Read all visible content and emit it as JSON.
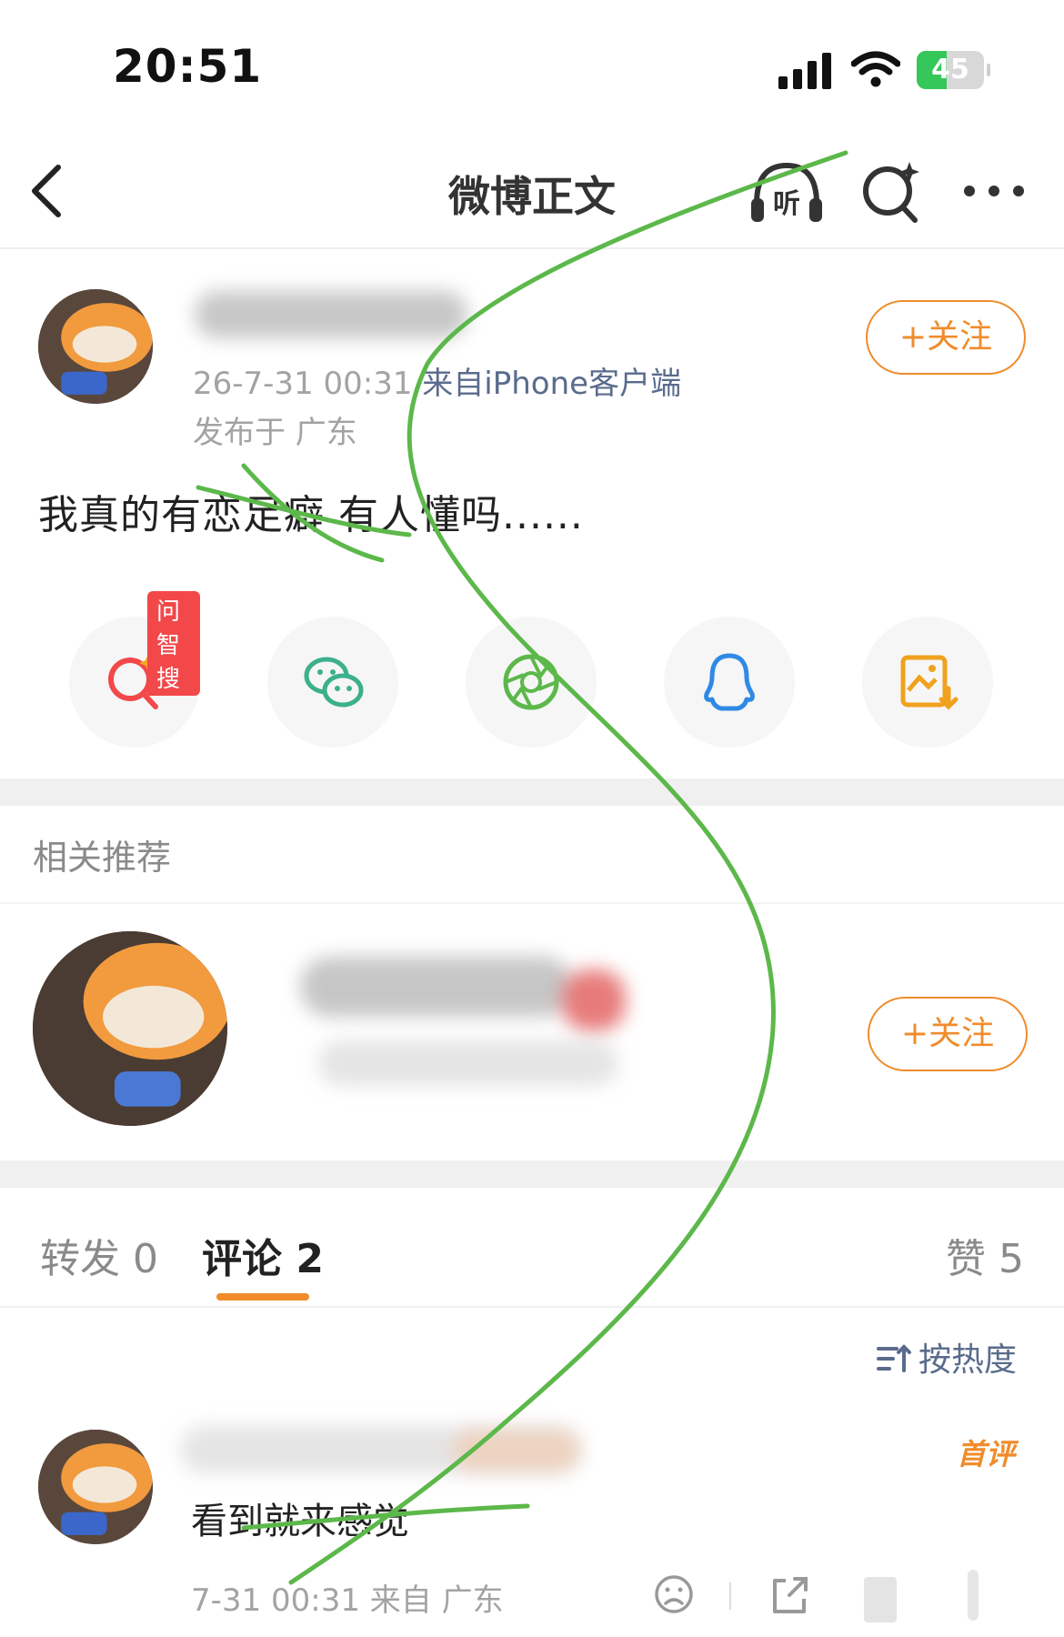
{
  "status_bar": {
    "time": "20:51",
    "battery": "45",
    "battery_level": 0.45
  },
  "nav": {
    "title": "微博正文",
    "listen_label": "听"
  },
  "post": {
    "meta_prefix": "26-7-31 00:31 ",
    "meta_source": "来自iPhone客户端",
    "location": "发布于 广东",
    "follow_label": "+关注",
    "text": "我真的有恋足癖 有人懂吗......"
  },
  "share": {
    "ai_badge": "问智搜",
    "buttons": [
      "search-ai",
      "wechat",
      "moments",
      "qq",
      "save-image"
    ]
  },
  "recommend": {
    "header": "相关推荐",
    "follow_label": "+关注"
  },
  "tabs": {
    "repost": "转发 0",
    "comment": "评论 2",
    "like": "赞 5"
  },
  "sort": {
    "label": "按热度"
  },
  "comment": {
    "badge": "首评",
    "text": "看到就来感觉",
    "meta": "7-31 00:31 来自 广东"
  },
  "colors": {
    "accent": "#f08c2c",
    "link": "#5a6b8c",
    "scribble": "#5cb84a",
    "badge_red": "#f2484a"
  }
}
